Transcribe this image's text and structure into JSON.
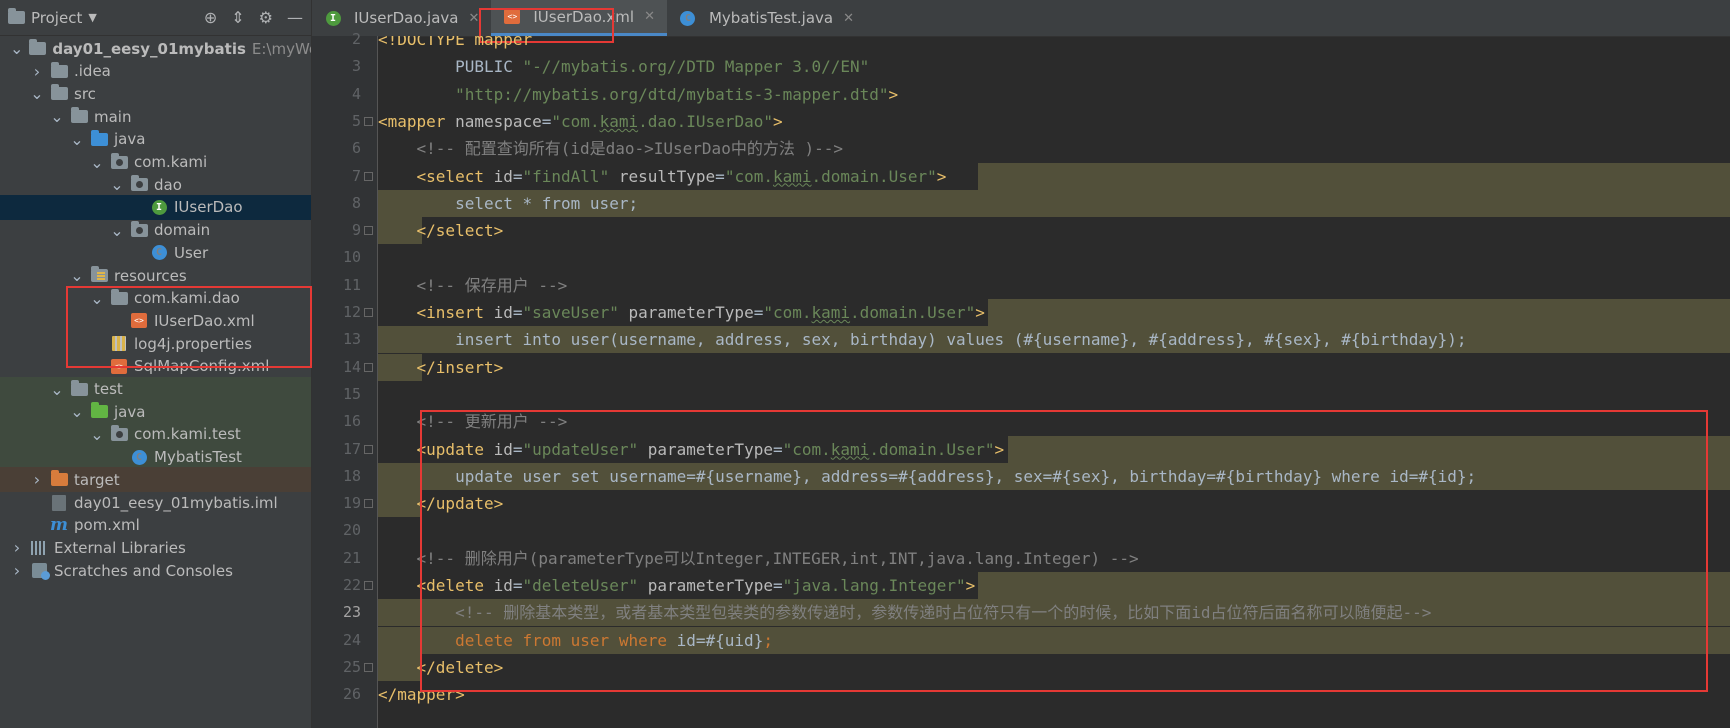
{
  "sidebar": {
    "title": "Project",
    "tree": [
      {
        "label": "day01_eesy_01mybatis",
        "path": "E:\\myWork",
        "depth": 0,
        "arrow": "open",
        "icon": "module-folder"
      },
      {
        "label": ".idea",
        "depth": 1,
        "arrow": "closed",
        "icon": "folder"
      },
      {
        "label": "src",
        "depth": 1,
        "arrow": "open",
        "icon": "folder"
      },
      {
        "label": "main",
        "depth": 2,
        "arrow": "open",
        "icon": "folder"
      },
      {
        "label": "java",
        "depth": 3,
        "arrow": "open",
        "icon": "source-folder"
      },
      {
        "label": "com.kami",
        "depth": 4,
        "arrow": "open",
        "icon": "package"
      },
      {
        "label": "dao",
        "depth": 5,
        "arrow": "open",
        "icon": "package"
      },
      {
        "label": "IUserDao",
        "depth": 6,
        "arrow": "none",
        "icon": "interface"
      },
      {
        "label": "domain",
        "depth": 5,
        "arrow": "open",
        "icon": "package"
      },
      {
        "label": "User",
        "depth": 6,
        "arrow": "none",
        "icon": "class"
      },
      {
        "label": "resources",
        "depth": 3,
        "arrow": "open",
        "icon": "resources-folder"
      },
      {
        "label": "com.kami.dao",
        "depth": 4,
        "arrow": "open",
        "icon": "folder"
      },
      {
        "label": "IUserDao.xml",
        "depth": 5,
        "arrow": "none",
        "icon": "xml-file"
      },
      {
        "label": "log4j.properties",
        "depth": 4,
        "arrow": "none",
        "icon": "properties-file"
      },
      {
        "label": "SqlMapConfig.xml",
        "depth": 4,
        "arrow": "none",
        "icon": "xml-file"
      },
      {
        "label": "test",
        "depth": 2,
        "arrow": "open",
        "icon": "folder"
      },
      {
        "label": "java",
        "depth": 3,
        "arrow": "open",
        "icon": "test-folder"
      },
      {
        "label": "com.kami.test",
        "depth": 4,
        "arrow": "open",
        "icon": "package"
      },
      {
        "label": "MybatisTest",
        "depth": 5,
        "arrow": "none",
        "icon": "class"
      },
      {
        "label": "target",
        "depth": 1,
        "arrow": "closed",
        "icon": "excluded-folder"
      },
      {
        "label": "day01_eesy_01mybatis.iml",
        "depth": 1,
        "arrow": "none",
        "icon": "iml-file"
      },
      {
        "label": "pom.xml",
        "depth": 1,
        "arrow": "none",
        "icon": "maven-file"
      },
      {
        "label": "External Libraries",
        "depth": 0,
        "arrow": "closed",
        "icon": "libraries"
      },
      {
        "label": "Scratches and Consoles",
        "depth": 0,
        "arrow": "closed",
        "icon": "scratches"
      }
    ]
  },
  "tabs": [
    {
      "label": "IUserDao.java",
      "icon": "interface",
      "active": false
    },
    {
      "label": "IUserDao.xml",
      "icon": "xml-file",
      "active": true
    },
    {
      "label": "MybatisTest.java",
      "icon": "class",
      "active": false
    }
  ],
  "editor": {
    "current_line": 23,
    "lines": [
      {
        "n": "2",
        "html": "<span class=\"t\">&lt;!DOCTYPE mapper</span>"
      },
      {
        "n": "3",
        "html": "        PUBLIC <span class=\"v\">\"-//mybatis.org//DTD Mapper 3.0//EN\"</span>"
      },
      {
        "n": "4",
        "html": "        <span class=\"v\">\"http://mybatis.org/dtd/mybatis-3-mapper.dtd\"</span><span class=\"t\">&gt;</span>"
      },
      {
        "n": "5",
        "html": "<span class=\"t\">&lt;mapper </span><span class=\"a\">namespace</span>=<span class=\"v\">\"com.<span class=\"u\">kami</span>.dao.IUserDao\"</span><span class=\"t\">&gt;</span>"
      },
      {
        "n": "6",
        "html": "    <span class=\"c\">&lt;!-- 配置查询所有(id是dao-&gt;IUserDao中的方法 )--&gt;</span>"
      },
      {
        "n": "7",
        "html": "    <span class=\"t\">&lt;select </span><span class=\"a\">id</span>=<span class=\"v\">\"findAll\"</span> <span class=\"a\">resultType</span>=<span class=\"v\">\"com.<span class=\"u\">kami</span>.domain.User\"</span><span class=\"t\">&gt;</span>"
      },
      {
        "n": "8",
        "html": "        <span class=\"sc\">select * from user;</span>"
      },
      {
        "n": "9",
        "html": "    <span class=\"t\">&lt;/select&gt;</span>"
      },
      {
        "n": "10",
        "html": ""
      },
      {
        "n": "11",
        "html": "    <span class=\"c\">&lt;!-- 保存用户 --&gt;</span>"
      },
      {
        "n": "12",
        "html": "    <span class=\"t\">&lt;insert </span><span class=\"a\">id</span>=<span class=\"v\">\"saveUser\"</span> <span class=\"a\">parameterType</span>=<span class=\"v\">\"com.<span class=\"u\">kami</span>.domain.User\"</span><span class=\"t\">&gt;</span>"
      },
      {
        "n": "13",
        "html": "        <span class=\"sc\">insert into user(username, address, sex, birthday) values (#{username}, #{address}, #{sex}, #{birthday});</span>"
      },
      {
        "n": "14",
        "html": "    <span class=\"t\">&lt;/insert&gt;</span>"
      },
      {
        "n": "15",
        "html": ""
      },
      {
        "n": "16",
        "html": "    <span class=\"c\">&lt;!-- 更新用户 --&gt;</span>"
      },
      {
        "n": "17",
        "html": "    <span class=\"t\">&lt;update </span><span class=\"a\">id</span>=<span class=\"v\">\"updateUser\"</span> <span class=\"a\">parameterType</span>=<span class=\"v\">\"com.<span class=\"u\">kami</span>.domain.User\"</span><span class=\"t\">&gt;</span>"
      },
      {
        "n": "18",
        "html": "        <span class=\"sc\">update user set username=#{username}, address=#{address}, sex=#{sex}, birthday=#{birthday} where id=#{id};</span>"
      },
      {
        "n": "19",
        "html": "    <span class=\"t\">&lt;/update&gt;</span>"
      },
      {
        "n": "20",
        "html": ""
      },
      {
        "n": "21",
        "html": "    <span class=\"c\">&lt;!-- 删除用户(parameterType可以Integer,INTEGER,int,INT,java.lang.Integer) --&gt;</span>"
      },
      {
        "n": "22",
        "html": "    <span class=\"t\">&lt;delete </span><span class=\"a\">id</span>=<span class=\"v\">\"deleteUser\"</span> <span class=\"a\">parameterType</span>=<span class=\"v\">\"java.lang.Integer\"</span><span class=\"t\">&gt;</span>"
      },
      {
        "n": "23",
        "html": "        <span class=\"c\">&lt;!-- 删除基本类型，或者基本类型包装类的参数传递时，参数传递时占位符只有一个的时候，比如下面id占位符后面名称可以随便起--&gt;</span>"
      },
      {
        "n": "24",
        "html": "        <span class=\"k\">delete from user where </span><span class=\"sc\">id=#{uid}</span><span class=\"k\">;</span>"
      },
      {
        "n": "25",
        "html": "    <span class=\"t\">&lt;/delete&gt;</span>"
      },
      {
        "n": "26",
        "html": "<span class=\"t\">&lt;/mapper&gt;</span>"
      }
    ]
  },
  "colors": {
    "accent": "#4a88c7",
    "highlight_box": "#e53935"
  }
}
